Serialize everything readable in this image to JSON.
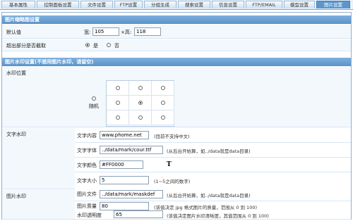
{
  "tabs": [
    "基本属性",
    "控制面板设置",
    "文件设置",
    "FTP设置",
    "分组生成",
    "搜索设置",
    "信息设置",
    "FTP/EMAIL",
    "模型设置",
    "图片设置"
  ],
  "active_tab_index": 9,
  "thumb": {
    "section_title": "图片缩略图设置",
    "default_label": "默认值",
    "width_label": "宽:",
    "width_value": "105",
    "height_label": "×高:",
    "height_value": "118",
    "crop_label": "超出部分是否截取",
    "yes_label": "是",
    "no_label": "否",
    "crop_selected": "yes"
  },
  "watermark": {
    "section_title": "图片水印设置(不想用图片水印，请留空)",
    "position_label": "水印位置",
    "random_label": "随机",
    "position_selected": "center"
  },
  "text_wm": {
    "label": "文字水印",
    "content_label": "文字内容",
    "content_value": "www.phome.net",
    "content_hint": "(目前不支持中文)",
    "font_label": "文字字体",
    "font_value": "../data/mark/cour.ttf",
    "font_hint": "(从后台开始算，如../data就是data目录)",
    "color_label": "文字颜色",
    "color_value": "#FF0000",
    "size_label": "文字大小",
    "size_value": "5",
    "size_hint": "(1~5之间的数字)"
  },
  "image_wm": {
    "label": "图片水印",
    "file_label": "图片文件",
    "file_value": "../data/mark/maskdef",
    "file_hint": "(从后台开始算，如../data就是data目录)",
    "quality_label": "图片质量",
    "quality_value": "80",
    "quality_hint": "(该值决定 jpg 格式图片的质量，范围从 0 到 100)",
    "alpha_label": "水印透明度",
    "alpha_value": "65",
    "alpha_hint": "(该值决定图片水印清晰度，其值范围从 0 到 100)"
  },
  "colors": {
    "section": "#5a93c9",
    "active_tab": "#5e96cc",
    "row_bg": "#f3f8fc"
  }
}
